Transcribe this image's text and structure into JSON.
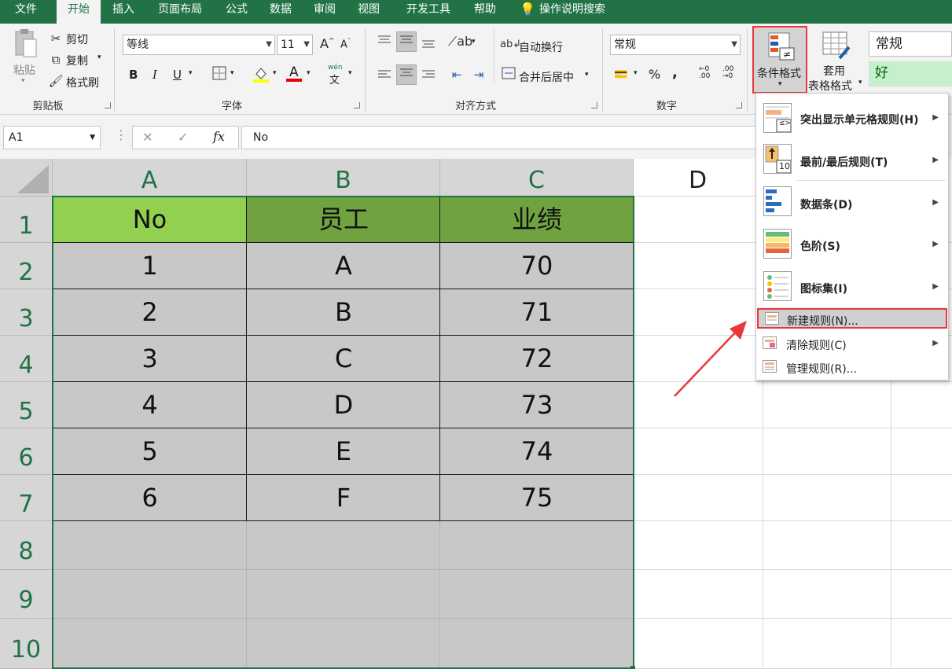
{
  "menu": {
    "tabs": [
      "文件",
      "开始",
      "插入",
      "页面布局",
      "公式",
      "数据",
      "审阅",
      "视图",
      "开发工具",
      "帮助"
    ],
    "search_label": "操作说明搜索"
  },
  "ribbon": {
    "clipboard": {
      "paste": "粘贴",
      "cut": "剪切",
      "copy": "复制",
      "format_painter": "格式刷",
      "label": "剪贴板"
    },
    "font": {
      "name": "等线",
      "size": "11",
      "grow": "A",
      "shrink": "A",
      "bold": "B",
      "italic": "I",
      "underline": "U",
      "phonetic": "wén",
      "label": "字体"
    },
    "alignment": {
      "wrap": "自动换行",
      "merge": "合并后居中",
      "label": "对齐方式"
    },
    "number": {
      "format": "常规",
      "percent": "%",
      "comma": ",",
      "label": "数字"
    },
    "styles": {
      "conditional": "条件格式",
      "table_line1": "套用",
      "table_line2": "表格格式",
      "style_normal": "常规",
      "style_good": "好"
    }
  },
  "formula_bar": {
    "name_box": "A1",
    "cancel": "✕",
    "enter": "✓",
    "fx": "fx",
    "content": "No"
  },
  "grid": {
    "columns": [
      "A",
      "B",
      "C",
      "D"
    ],
    "rows": [
      "1",
      "2",
      "3",
      "4",
      "5",
      "6",
      "7",
      "8",
      "9",
      "10"
    ],
    "header": [
      "No",
      "员工",
      "业绩"
    ],
    "data": [
      [
        "1",
        "A",
        "70"
      ],
      [
        "2",
        "B",
        "71"
      ],
      [
        "3",
        "C",
        "72"
      ],
      [
        "4",
        "D",
        "73"
      ],
      [
        "5",
        "E",
        "74"
      ],
      [
        "6",
        "F",
        "75"
      ]
    ]
  },
  "dropdown": {
    "items": [
      {
        "label": "突出显示单元格规则(H)",
        "has_submenu": true
      },
      {
        "label": "最前/最后规则(T)",
        "has_submenu": true
      },
      {
        "label": "数据条(D)",
        "has_submenu": true
      },
      {
        "label": "色阶(S)",
        "has_submenu": true
      },
      {
        "label": "图标集(I)",
        "has_submenu": true
      },
      {
        "label": "新建规则(N)...",
        "has_submenu": false
      },
      {
        "label": "清除规则(C)",
        "has_submenu": true
      },
      {
        "label": "管理规则(R)...",
        "has_submenu": false
      }
    ],
    "icon_text": {
      "highlight": "≤>",
      "top10": "10"
    }
  },
  "colors": {
    "accent": "#217346",
    "header_cell_a": "#92d050",
    "header_cell_bc": "#70a340",
    "selection_gray": "#c8c8c8",
    "highlight_red": "#e8383d"
  }
}
